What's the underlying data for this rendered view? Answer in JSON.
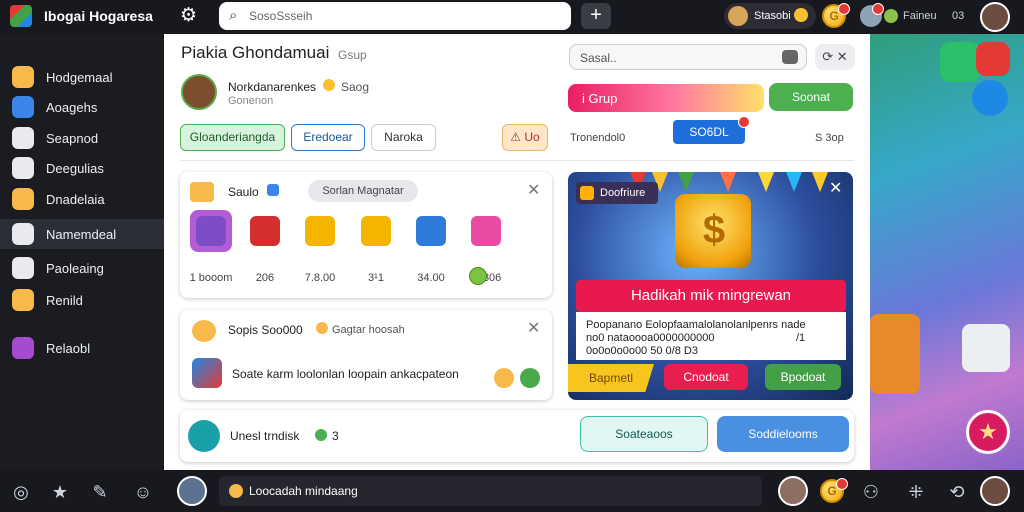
{
  "topbar": {
    "app_title": "Ibogai Hogaresa",
    "search_placeholder": "SosoSsseih",
    "user_name": "Stasobi",
    "coin_letter": "G",
    "gift_text": "Faineu",
    "gift_count": "03",
    "icons": [
      "logo-icon",
      "gear-icon",
      "search-icon",
      "plus-icon",
      "coin-icon",
      "notification-icon",
      "profile-avatar-icon"
    ]
  },
  "sidebar": {
    "items": [
      {
        "label": "Hodgemaal",
        "icon": "gamepad-icon",
        "color": "#f6b94a"
      },
      {
        "label": "Aoagehs",
        "icon": "grid-icon",
        "color": "#3b86e8"
      },
      {
        "label": "Seapnod",
        "icon": "discord-icon",
        "color": "#e8eaed"
      },
      {
        "label": "Deegulias",
        "icon": "chat-icon",
        "color": "#e8eaed"
      },
      {
        "label": "Dnadelaia",
        "icon": "coin-stack-icon",
        "color": "#f6b94a"
      },
      {
        "label": "Namemdeal",
        "icon": "star-icon",
        "color": "#e8eaed",
        "active": true
      },
      {
        "label": "Paoleaing",
        "icon": "controller-icon",
        "color": "#e8eaed"
      },
      {
        "label": "Renild",
        "icon": "coin-icon",
        "color": "#f6b94a"
      },
      {
        "label": "Relaobl",
        "icon": "avatar-icon",
        "color": "#a64bd0"
      }
    ]
  },
  "main": {
    "title": "Piakia Ghondamuai",
    "group_label": "Gsup",
    "profile": {
      "name": "Norkdanarenkes",
      "tag": "Saog",
      "subtitle": "Gonenon"
    },
    "search_text": "Sasal..",
    "grup_label": "i Grup",
    "green_btn": "Soonat",
    "pills": [
      "Gloanderiangda",
      "Eredoear",
      "Naroka"
    ],
    "warn_label": "Uo",
    "mid_text": "Tronendol0",
    "blue_btn": "SO6DL",
    "right_text": "S 3op",
    "card1": {
      "title": "Saulo",
      "pill": "Sorlan Magnatar",
      "gifts": [
        {
          "price": "1 booom",
          "icon": "gamepad-gift-icon",
          "color": "#7c4dc7"
        },
        {
          "price": "206",
          "icon": "present-box-icon",
          "color": "#d32f2f"
        },
        {
          "price": "7.8.00",
          "icon": "coin-heap-icon",
          "color": "#f4b400"
        },
        {
          "price": "3¹1",
          "icon": "coin-heap-icon",
          "color": "#f4b400"
        },
        {
          "price": "34.00",
          "icon": "gem-icon",
          "color": "#2f7bd9"
        },
        {
          "price": "32306",
          "icon": "gift-ribbon-icon",
          "color": "#e94aa4"
        }
      ]
    },
    "card2": {
      "title": "Sopis Soo000",
      "subtitle": "Gagtar hoosah",
      "description": "Soate karm loolonlan loopain ankacpateon"
    },
    "card3": {
      "title": "Unesl trndisk",
      "number": "3",
      "btn1": "Soateaoos",
      "btn2": "Soddielooms"
    },
    "promo": {
      "badge": "Doofriure",
      "headline": "Hadikah mik mingrewan",
      "line1": "Poopanano Eolopfaamalolanolanlpenrs nade",
      "line2": "no0 nataoooa0000000000",
      "line3": "0o0o0o0o00 50 0/8 D3",
      "right_text": "/1",
      "yellow_btn": "Bapmetl",
      "red_btn": "Cnodoat",
      "green_btn": "Bpodoat"
    }
  },
  "bottombar": {
    "chat_text": "Loocadah mindaang"
  }
}
